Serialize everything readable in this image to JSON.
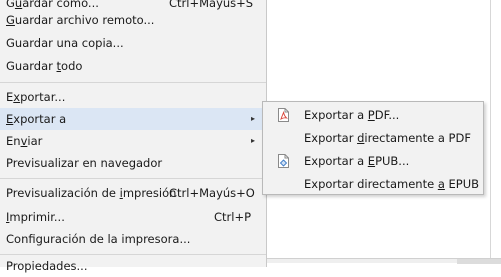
{
  "file_menu": {
    "items": [
      {
        "label": "Guardar como...",
        "accel": "Ctrl+Mayús+S"
      },
      {
        "label": "Guardar archivo remoto...",
        "accel": ""
      },
      {
        "label": "Guardar una copia...",
        "accel": ""
      },
      {
        "label": "Guardar todo",
        "accel": ""
      },
      {
        "label": "Exportar...",
        "accel": ""
      },
      {
        "label": "Exportar a",
        "accel": ""
      },
      {
        "label": "Enviar",
        "accel": ""
      },
      {
        "label": "Previsualizar en navegador",
        "accel": ""
      },
      {
        "label": "Previsualización de impresión",
        "accel": "Ctrl+Mayús+O"
      },
      {
        "label": "Imprimir...",
        "accel": "Ctrl+P"
      },
      {
        "label": "Configuración de la impresora...",
        "accel": ""
      },
      {
        "label": "Propiedades...",
        "accel": ""
      }
    ],
    "submenu_arrow": "▸"
  },
  "export_submenu": {
    "items": [
      {
        "label": "Exportar a PDF...",
        "icon": "pdf-file-icon"
      },
      {
        "label": "Exportar directamente a PDF",
        "icon": ""
      },
      {
        "label": "Exportar a EPUB...",
        "icon": "epub-file-icon"
      },
      {
        "label": "Exportar directamente a EPUB",
        "icon": ""
      }
    ]
  },
  "colors": {
    "menu_bg": "#f2f2f2",
    "highlight": "#dbe6f4",
    "pdf_icon_accent": "#d9453a",
    "epub_icon_accent": "#3b79c4"
  }
}
